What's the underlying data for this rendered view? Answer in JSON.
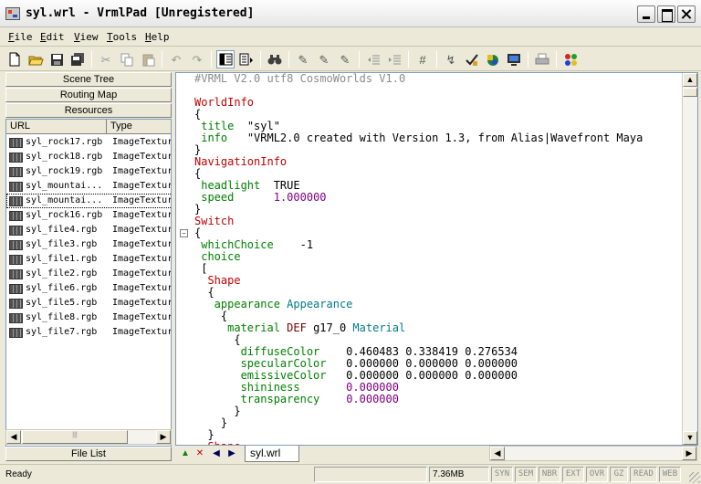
{
  "window": {
    "title": "syl.wrl - VrmlPad [Unregistered]"
  },
  "menu": [
    {
      "u": "F",
      "rest": "ile"
    },
    {
      "u": "E",
      "rest": "dit"
    },
    {
      "u": "V",
      "rest": "iew"
    },
    {
      "u": "T",
      "rest": "ools"
    },
    {
      "u": "H",
      "rest": "elp"
    }
  ],
  "panel": {
    "buttons": [
      "Scene Tree",
      "Routing Map",
      "Resources"
    ],
    "columns": [
      "URL",
      "Type"
    ],
    "rows": [
      {
        "name": "syl_rock17.rgb",
        "type": "ImageTextur"
      },
      {
        "name": "syl_rock18.rgb",
        "type": "ImageTextur"
      },
      {
        "name": "syl_rock19.rgb",
        "type": "ImageTextur"
      },
      {
        "name": "syl_mountai...",
        "type": "ImageTextur"
      },
      {
        "name": "syl_mountai...",
        "type": "ImageTextur"
      },
      {
        "name": "syl_rock16.rgb",
        "type": "ImageTextur"
      },
      {
        "name": "syl_file4.rgb",
        "type": "ImageTextur"
      },
      {
        "name": "syl_file3.rgb",
        "type": "ImageTextur"
      },
      {
        "name": "syl_file1.rgb",
        "type": "ImageTextur"
      },
      {
        "name": "syl_file2.rgb",
        "type": "ImageTextur"
      },
      {
        "name": "syl_file6.rgb",
        "type": "ImageTextur"
      },
      {
        "name": "syl_file5.rgb",
        "type": "ImageTextur"
      },
      {
        "name": "syl_file8.rgb",
        "type": "ImageTextur"
      },
      {
        "name": "syl_file7.rgb",
        "type": "ImageTextur"
      }
    ],
    "selected_row": 4,
    "file_list_label": "File List"
  },
  "code": {
    "lines": [
      [
        [
          "cm",
          "#VRML V2.0 utf8 CosmoWorlds V1.0"
        ]
      ],
      [],
      [
        [
          "kw",
          "WorldInfo"
        ]
      ],
      [
        [
          "pl",
          "{"
        ]
      ],
      [
        [
          "fld",
          " title"
        ],
        [
          "pl",
          "  "
        ],
        [
          "str",
          "\"syl\""
        ]
      ],
      [
        [
          "fld",
          " info"
        ],
        [
          "pl",
          "   "
        ],
        [
          "str",
          "\"VRML2.0 created with Version 1.3, from Alias|Wavefront Maya"
        ]
      ],
      [
        [
          "pl",
          "}"
        ]
      ],
      [
        [
          "kw",
          "NavigationInfo"
        ]
      ],
      [
        [
          "pl",
          "{"
        ]
      ],
      [
        [
          "fld",
          " headlight"
        ],
        [
          "pl",
          "  TRUE"
        ]
      ],
      [
        [
          "fld",
          " speed"
        ],
        [
          "pl",
          "      "
        ],
        [
          "num",
          "1.000000"
        ]
      ],
      [
        [
          "pl",
          "}"
        ]
      ],
      [
        [
          "kw",
          "Switch"
        ]
      ],
      [
        [
          "pl",
          "{"
        ]
      ],
      [
        [
          "fld",
          " whichChoice"
        ],
        [
          "pl",
          "    -1"
        ]
      ],
      [
        [
          "fld",
          " choice"
        ]
      ],
      [
        [
          "pl",
          " ["
        ]
      ],
      [
        [
          "kw",
          "  Shape"
        ]
      ],
      [
        [
          "pl",
          "  {"
        ]
      ],
      [
        [
          "fld",
          "   appearance"
        ],
        [
          "pl",
          " "
        ],
        [
          "ty",
          "Appearance"
        ]
      ],
      [
        [
          "pl",
          "    {"
        ]
      ],
      [
        [
          "fld",
          "     material"
        ],
        [
          "pl",
          " "
        ],
        [
          "def",
          "DEF"
        ],
        [
          "pl",
          " g17_0 "
        ],
        [
          "ty",
          "Material"
        ]
      ],
      [
        [
          "pl",
          "      {"
        ]
      ],
      [
        [
          "fld",
          "       diffuseColor"
        ],
        [
          "pl",
          "    0.460483 0.338419 0.276534"
        ]
      ],
      [
        [
          "fld",
          "       specularColor"
        ],
        [
          "pl",
          "   0.000000 0.000000 0.000000"
        ]
      ],
      [
        [
          "fld",
          "       emissiveColor"
        ],
        [
          "pl",
          "   0.000000 0.000000 0.000000"
        ]
      ],
      [
        [
          "fld",
          "       shininess"
        ],
        [
          "pl",
          "       "
        ],
        [
          "num",
          "0.000000"
        ]
      ],
      [
        [
          "fld",
          "       transparency"
        ],
        [
          "pl",
          "    "
        ],
        [
          "num",
          "0.000000"
        ]
      ],
      [
        [
          "pl",
          "      }"
        ]
      ],
      [
        [
          "pl",
          "    }"
        ]
      ],
      [
        [
          "pl",
          "  }"
        ]
      ],
      [
        [
          "kw",
          "  Shape"
        ]
      ]
    ],
    "fold_markers": [
      {
        "line": 13,
        "sign": "−"
      }
    ]
  },
  "tabs": {
    "active": "syl.wrl"
  },
  "status": {
    "message": "Ready",
    "memory": "7.36MB",
    "indicators": [
      "SYN",
      "SEM",
      "NBR",
      "EXT",
      "OVR",
      "GZ",
      "READ",
      "WEB"
    ]
  }
}
